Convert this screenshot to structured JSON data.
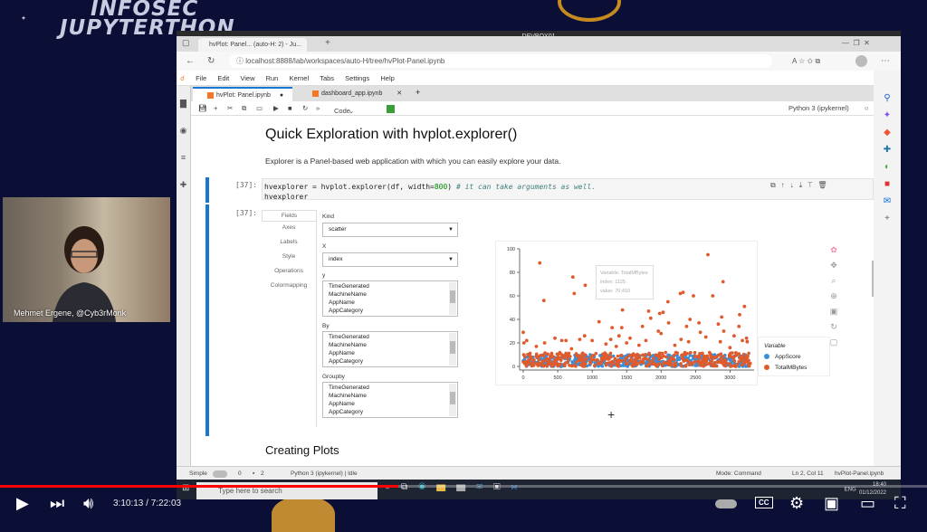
{
  "overlay": {
    "brand_line1": "INFOSEC",
    "brand_line2": "JUPYTERTHON",
    "small_logo": "INFOSEC JUPYTERTHON",
    "presenter": "Mehmet Ergene, @Cyb3rMonk"
  },
  "window": {
    "title": "DEVBOX01",
    "tab_title": "hvPlot: Panel... (auto-H: 2) - Ju...",
    "url": "localhost:8888/lab/workspaces/auto-H/tree/hvPlot-Panel.ipynb"
  },
  "jupyter": {
    "menu": [
      "File",
      "Edit",
      "View",
      "Run",
      "Kernel",
      "Tabs",
      "Settings",
      "Help"
    ],
    "tabs": [
      {
        "label": "hvPlot: Panel.ipynb"
      },
      {
        "label": "dashboard_app.ipynb"
      }
    ],
    "cell_type": "Code",
    "kernel": "Python 3 (ipykernel)"
  },
  "notebook": {
    "heading": "Quick Exploration with hvplot.explorer()",
    "paragraph": "Explorer is a Panel-based web application with which you can easily explore your data.",
    "in_prompt": "[37]:",
    "out_prompt": "[37]:",
    "code_line1_a": "hvexplorer = hvplot.explorer(df, width=",
    "code_line1_num": "800",
    "code_line1_b": ") ",
    "code_comment": "# it can take arguments as well.",
    "code_line2": "hvexplorer",
    "heading2": "Creating Plots"
  },
  "explorer": {
    "tabs": [
      "Fields",
      "Axes",
      "Labels",
      "Style",
      "Operations",
      "Colormapping"
    ],
    "kind_label": "Kind",
    "kind_value": "scatter",
    "x_label": "X",
    "x_value": "index",
    "y_label": "y",
    "by_label": "By",
    "groupby_label": "Groupby",
    "columns": [
      "TimeGenerated",
      "MachineName",
      "AppName",
      "AppCategory"
    ],
    "legend_title": "Variable",
    "tooltip": [
      "Variable: TotalMBytes",
      "index: 1125",
      "value: 70.410"
    ]
  },
  "chart_data": {
    "type": "scatter",
    "xlim": [
      0,
      3350
    ],
    "ylim": [
      0,
      100
    ],
    "xticks": [
      0,
      500,
      1000,
      1500,
      2000,
      2500,
      3000
    ],
    "yticks": [
      0,
      20,
      40,
      60,
      80,
      100
    ],
    "legend": "right",
    "series": [
      {
        "name": "AppScore",
        "color": "#3a8fd8",
        "band": [
          0,
          10
        ]
      },
      {
        "name": "TotalMBytes",
        "color": "#e05a2b",
        "band": [
          0,
          12
        ],
        "points": [
          [
            240,
            88
          ],
          [
            300,
            56
          ],
          [
            720,
            76
          ],
          [
            740,
            62
          ],
          [
            900,
            69
          ],
          [
            1110,
            70
          ],
          [
            1100,
            38
          ],
          [
            1440,
            48
          ],
          [
            2280,
            62
          ],
          [
            2320,
            63
          ],
          [
            2470,
            60
          ],
          [
            2680,
            95
          ],
          [
            2750,
            60
          ],
          [
            2900,
            72
          ],
          [
            2100,
            55
          ],
          [
            1980,
            45
          ],
          [
            2030,
            46
          ],
          [
            1820,
            47
          ],
          [
            1850,
            41
          ],
          [
            2420,
            40
          ],
          [
            2110,
            37
          ],
          [
            2550,
            37
          ],
          [
            2830,
            36
          ],
          [
            2880,
            42
          ],
          [
            3140,
            44
          ],
          [
            3210,
            51
          ],
          [
            3130,
            34
          ],
          [
            2370,
            34
          ],
          [
            1730,
            34
          ],
          [
            0,
            29
          ],
          [
            50,
            22
          ],
          [
            10,
            20
          ],
          [
            190,
            17
          ],
          [
            310,
            20
          ],
          [
            460,
            24
          ],
          [
            560,
            22
          ],
          [
            890,
            26
          ],
          [
            1290,
            33
          ],
          [
            1430,
            33
          ],
          [
            1390,
            26
          ],
          [
            1550,
            24
          ],
          [
            1960,
            30
          ],
          [
            2000,
            28
          ],
          [
            2570,
            29
          ],
          [
            2910,
            30
          ],
          [
            3060,
            26
          ],
          [
            3240,
            24
          ],
          [
            1270,
            23
          ],
          [
            1780,
            22
          ],
          [
            2290,
            23
          ],
          [
            2860,
            21
          ],
          [
            3000,
            16
          ],
          [
            3250,
            21
          ],
          [
            1680,
            18
          ],
          [
            620,
            22
          ],
          [
            820,
            23
          ],
          [
            1000,
            22
          ],
          [
            1200,
            19
          ],
          [
            1500,
            20
          ],
          [
            2200,
            18
          ],
          [
            2650,
            25
          ],
          [
            2400,
            21
          ],
          [
            3180,
            22
          ],
          [
            700,
            15
          ],
          [
            1350,
            17
          ]
        ]
      }
    ]
  },
  "status": {
    "mode_label": "Simple",
    "counts_a": "0",
    "counts_b": "2",
    "kernel_state": "Python 3 (ipykernel) | Idle",
    "mode": "Mode: Command",
    "position": "Ln 2, Col 11",
    "file": "hvPlot-Panel.ipynb"
  },
  "taskbar": {
    "search_placeholder": "Type here to search",
    "lang": "ENG",
    "clock": "18:40",
    "date": "01/12/2022"
  },
  "player": {
    "current": "3:10:13",
    "duration": "7:22:03",
    "time_sep": " / ",
    "progress": 0.43
  }
}
